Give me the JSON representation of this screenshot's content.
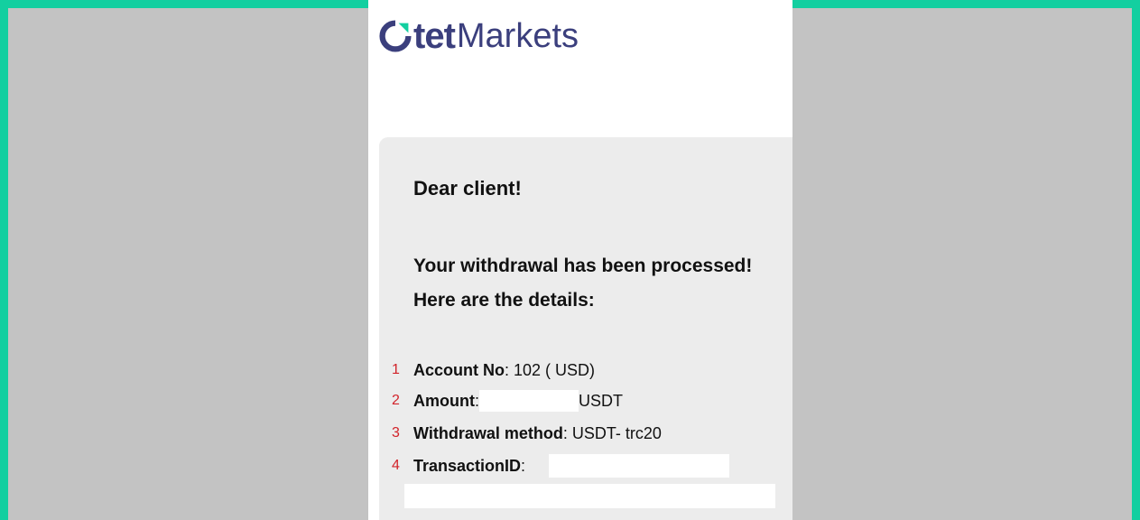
{
  "logo": {
    "prefix": "tet",
    "suffix": "Markets",
    "brand_color": "#3b3f7d",
    "accent_color": "#13cfa0"
  },
  "greeting": "Dear client!",
  "intro": "Your withdrawal has been processed! Here are the details:",
  "details": [
    {
      "num": "1",
      "label": "Account No",
      "value": ": 102 ( USD)"
    },
    {
      "num": "2",
      "label": "Amount",
      "value_prefix": ": ",
      "value_suffix": " USDT"
    },
    {
      "num": "3",
      "label": "Withdrawal method",
      "value": ": USDT- trc20"
    },
    {
      "num": "4",
      "label": "TransactionID",
      "value": ":"
    }
  ],
  "colors": {
    "frame": "#13cfa0",
    "backdrop": "#c3c3c3",
    "card": "#ececec",
    "marker": "#d2232a"
  }
}
